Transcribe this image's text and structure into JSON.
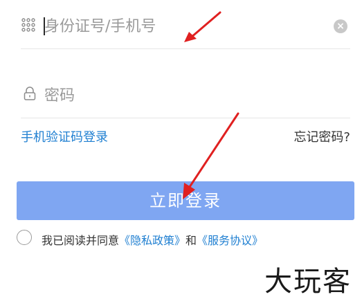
{
  "login_form": {
    "account_placeholder": "身份证号/手机号",
    "password_placeholder": "密码",
    "clear_glyph": "×",
    "sms_login_link": "手机验证码登录",
    "forgot_password_link": "忘记密码?",
    "login_button": "立即登录",
    "agreement": {
      "prefix": "我已阅读并同意",
      "privacy_policy": "《隐私政策》",
      "conjunction": "和",
      "service_agreement": "《服务协议》"
    }
  },
  "watermark": "大玩客",
  "colors": {
    "link": "#1f7fd1",
    "button": "#7fa6f2",
    "annotation_arrow": "#e02020"
  },
  "icons": [
    "keypad-icon",
    "lock-icon",
    "clear-icon"
  ]
}
